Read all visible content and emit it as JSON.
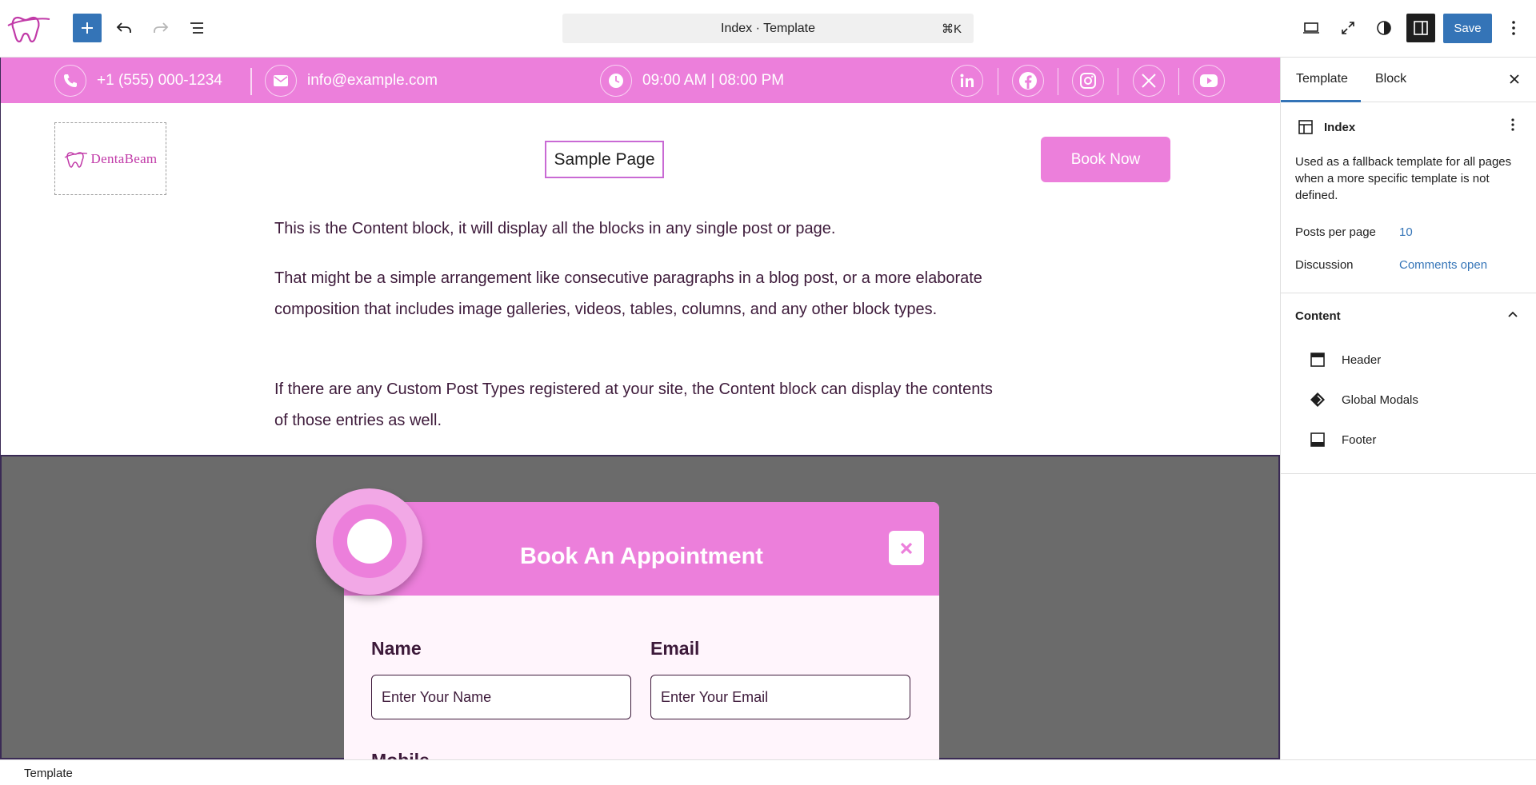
{
  "toolbar": {
    "command_title": "Index · Template",
    "command_shortcut": "⌘K",
    "save_label": "Save"
  },
  "site": {
    "phone": "+1 (555) 000-1234",
    "email": "info@example.com",
    "hours": "09:00 AM | 08:00 PM",
    "logo_text": "DentaBeam",
    "nav_link": "Sample Page",
    "book_now": "Book Now",
    "social": [
      "linkedin-icon",
      "facebook-icon",
      "instagram-icon",
      "x-icon",
      "youtube-icon"
    ],
    "accent_color": "#ec7fdb"
  },
  "content": {
    "p1": "This is the Content block, it will display all the blocks in any single post or page.",
    "p2": "That might be a simple arrangement like consecutive paragraphs in a blog post, or a more elaborate composition that includes image galleries, videos, tables, columns, and any other block types.",
    "p3": "If there are any Custom Post Types registered at your site, the Content block can display the contents of those entries as well."
  },
  "modal": {
    "title": "Book An Appointment",
    "name_label": "Name",
    "name_placeholder": "Enter Your Name",
    "email_label": "Email",
    "email_placeholder": "Enter Your Email",
    "mobile_label": "Mobile"
  },
  "sidebar": {
    "tabs": [
      "Template",
      "Block"
    ],
    "template_name": "Index",
    "description": "Used as a fallback template for all pages when a more specific template is not defined.",
    "posts_per_page_label": "Posts per page",
    "posts_per_page_value": "10",
    "discussion_label": "Discussion",
    "discussion_value": "Comments open",
    "content_heading": "Content",
    "content_items": [
      "Header",
      "Global Modals",
      "Footer"
    ]
  },
  "bottombar": {
    "label": "Template"
  },
  "colors": {
    "wp_blue": "#3474b7",
    "pink": "#ec7fdb",
    "text_purple": "#3d1a3a",
    "overlay_gray": "#6b6b6b"
  }
}
